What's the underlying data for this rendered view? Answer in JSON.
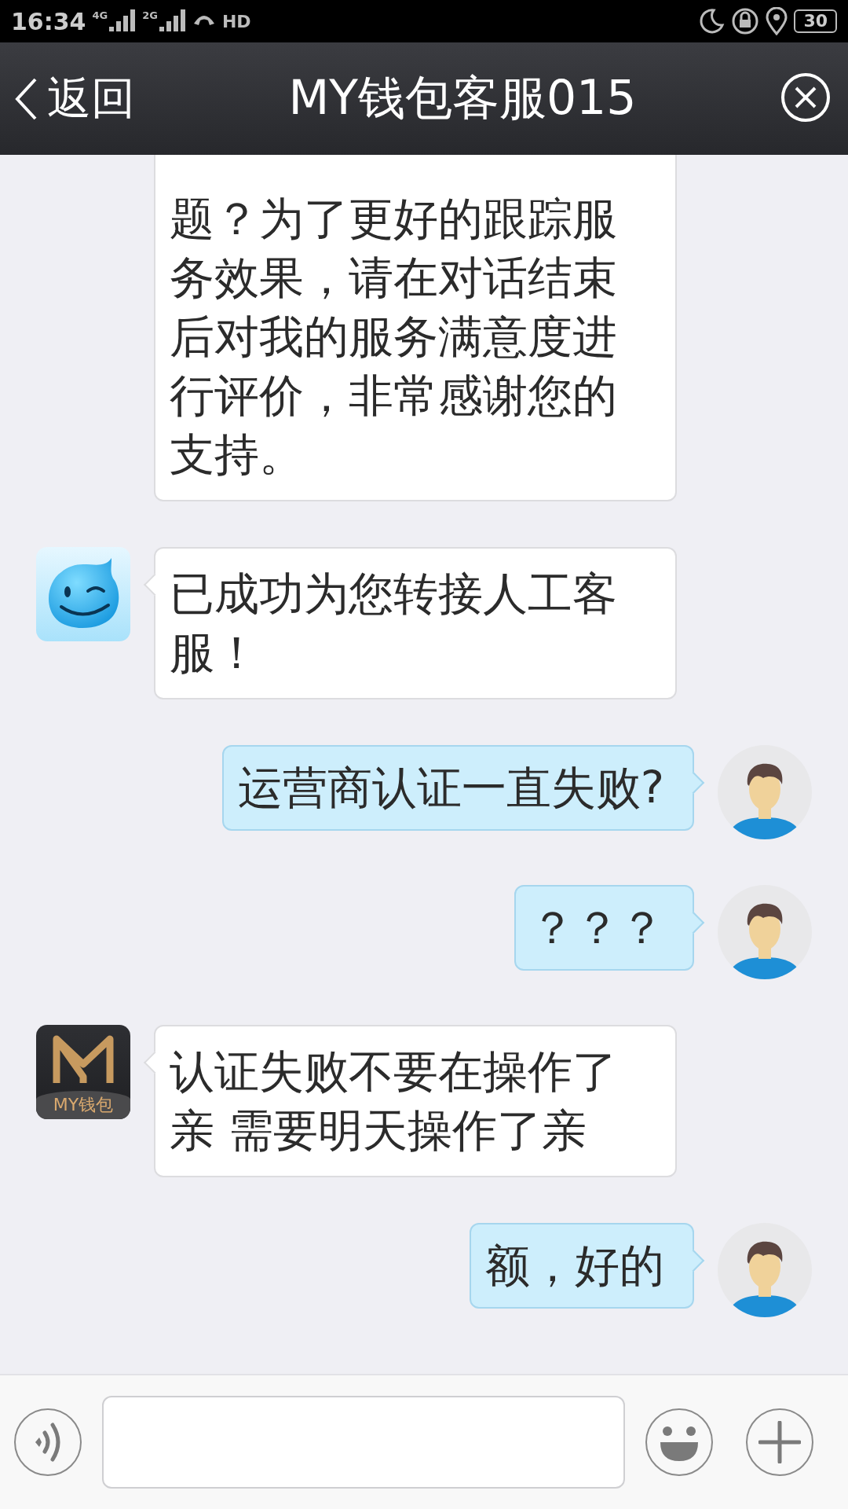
{
  "status_bar": {
    "time": "16:34",
    "network_1": "4G",
    "network_2": "2G",
    "hd": "HD",
    "battery": "30"
  },
  "header": {
    "back_label": "返回",
    "title": "MY钱包客服015"
  },
  "messages": [
    {
      "kind": "incoming",
      "avatar": {
        "kind": "none"
      },
      "text": "题？为了更好的跟踪服务效果，请在对话结束后对我的服务满意度进行评价，非常感谢您的支持。"
    },
    {
      "kind": "incoming",
      "avatar": {
        "kind": "smiley"
      },
      "text": "已成功为您转接人工客服！"
    },
    {
      "kind": "outgoing",
      "avatar": {
        "kind": "person"
      },
      "text": "运营商认证一直失败?"
    },
    {
      "kind": "outgoing",
      "avatar": {
        "kind": "person"
      },
      "text": "？？？"
    },
    {
      "kind": "incoming",
      "avatar": {
        "kind": "brand",
        "label": "MY钱包"
      },
      "text": "认证失败不要在操作了亲  需要明天操作了亲"
    },
    {
      "kind": "outgoing",
      "avatar": {
        "kind": "person"
      },
      "text": "额，好的"
    }
  ]
}
